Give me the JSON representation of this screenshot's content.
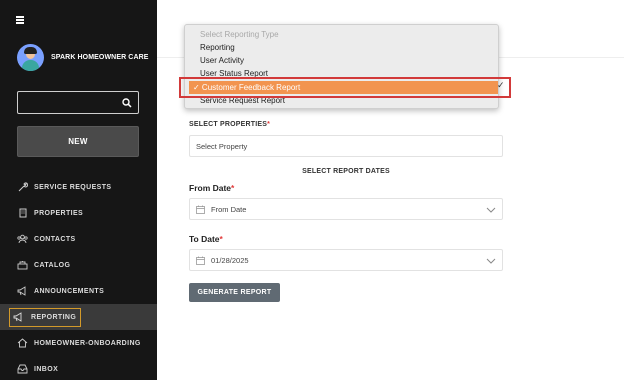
{
  "sidebar": {
    "brand_name": "SPARK HOMEOWNER CARE",
    "search": {
      "value": "",
      "placeholder": ""
    },
    "new_label": "NEW",
    "items": [
      {
        "label": "SERVICE REQUESTS",
        "icon": "wrench-icon"
      },
      {
        "label": "PROPERTIES",
        "icon": "building-icon"
      },
      {
        "label": "CONTACTS",
        "icon": "people-icon"
      },
      {
        "label": "CATALOG",
        "icon": "catalog-icon"
      },
      {
        "label": "ANNOUNCEMENTS",
        "icon": "megaphone-icon"
      },
      {
        "label": "REPORTING",
        "icon": "megaphone-icon",
        "active": true
      },
      {
        "label": "HOMEOWNER-ONBOARDING",
        "icon": "home-icon"
      },
      {
        "label": "INBOX",
        "icon": "inbox-icon"
      }
    ]
  },
  "dropdown": {
    "placeholder": "Select Reporting Type",
    "options": [
      "Reporting",
      "User Activity",
      "User Status Report",
      "Customer Feedback Report",
      "Service Request Report"
    ],
    "selected_label": "✓ Customer Feedback Report",
    "check_mark": "✓"
  },
  "form": {
    "properties_label": "SELECT PROPERTIES",
    "required_mark": "*",
    "property_placeholder": "Select Property",
    "report_dates_title": "SELECT REPORT DATES",
    "from_label": "From Date",
    "from_value": "From Date",
    "to_label": "To Date",
    "to_value": "01/28/2025",
    "generate_label": "GENERATE REPORT"
  },
  "colors": {
    "sidebar_bg": "#161616",
    "selected_option": "#f2944f",
    "highlight_border": "#d23a3a",
    "active_border": "#d39a2a",
    "button": "#606a73",
    "required": "#e23b3b"
  }
}
